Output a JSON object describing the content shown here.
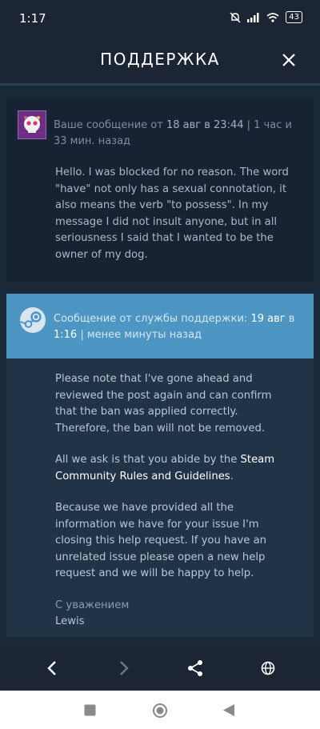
{
  "status_bar": {
    "time": "1:17",
    "battery": "43"
  },
  "header": {
    "title": "ПОДДЕРЖКА",
    "close_icon": "close-icon"
  },
  "user_message": {
    "meta_prefix": "Ваше сообщение от ",
    "meta_datetime": "18 авг в 23:44",
    "meta_suffix": " | 1 час и 33 мин. назад",
    "text": "Hello. I was blocked for no reason. The word \"have\" not only has a sexual connotation, it also means the verb \"to possess\". In my message I did not insult anyone, but in all seriousness I said that I wanted to be the owner of my dog."
  },
  "support_message": {
    "meta_prefix": "Сообщение от службы поддержки: ",
    "meta_date": "19 авг",
    "meta_mid": " в ",
    "meta_time": "1:16",
    "meta_suffix": " | менее минуты назад",
    "paragraph1": "Please note that I've gone ahead and reviewed the post again and can confirm that the ban was applied correctly. Therefore, the ban will not be removed.",
    "paragraph2_prefix": "All we ask is that you abide by the ",
    "paragraph2_link": "Steam Community Rules and Guidelines",
    "paragraph2_suffix": ".",
    "paragraph3": "Because we have provided all the information we have for your issue I'm closing this help request. If you have an unrelated issue please open a new help request and we will be happy to help.",
    "signature_line1": "С уважением",
    "signature_line2": "Lewis"
  },
  "bottom_nav": {
    "back_icon": "chevron-left-icon",
    "forward_icon": "chevron-right-icon",
    "share_icon": "share-icon",
    "globe_icon": "globe-icon"
  },
  "colors": {
    "background": "#1b2838",
    "support_header": "#4d95c2",
    "support_body": "#213347",
    "user_card": "#172332"
  }
}
